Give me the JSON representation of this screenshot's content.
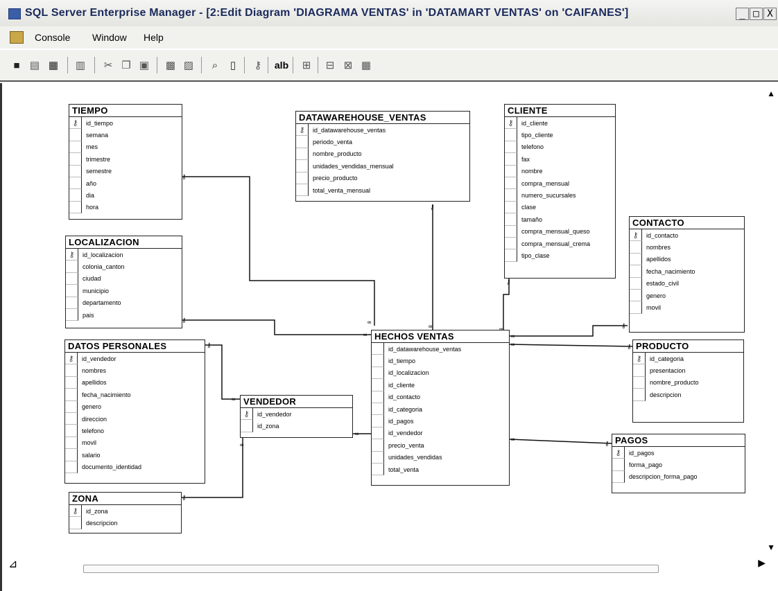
{
  "window": {
    "title": "SQL Server Enterprise Manager - [2:Edit Diagram 'DIAGRAMA VENTAS' in 'DATAMART VENTAS' on 'CAIFANES']",
    "controls": [
      "_",
      "□",
      "X"
    ],
    "doc_controls": [
      "_",
      "▫",
      "X"
    ]
  },
  "menu": {
    "items": [
      {
        "label": "Console"
      },
      {
        "label": "Window"
      },
      {
        "label": "Help"
      }
    ]
  },
  "toolbar": {
    "icons": [
      "save-icon",
      "properties-icon",
      "print-icon",
      "copy-table-icon",
      "cut-icon",
      "copy-icon",
      "paste-icon",
      "new-table-icon",
      "add-table-icon",
      "zoom-icon",
      "page-icon",
      "key-icon",
      "text-label-icon",
      "arrange-icon",
      "relationship-icon",
      "layout-icon",
      "grid-icon"
    ]
  },
  "tables": [
    {
      "id": "tiempo",
      "name": "TIEMPO",
      "fields": [
        "id_tiempo",
        "semana",
        "mes",
        "trimestre",
        "semestre",
        "año",
        "dia",
        "hora"
      ],
      "key_index": 0
    },
    {
      "id": "localizacion",
      "name": "LOCALIZACION",
      "fields": [
        "id_localizacion",
        "colonia_canton",
        "ciudad",
        "municipio",
        "departamento",
        "pais"
      ],
      "key_index": 0
    },
    {
      "id": "datos_personales",
      "name": "DATOS PERSONALES",
      "fields": [
        "id_vendedor",
        "nombres",
        "apellidos",
        "fecha_nacimiento",
        "genero",
        "direccion",
        "telefono",
        "movil",
        "salario",
        "documento_identidad"
      ],
      "key_index": 0
    },
    {
      "id": "zona",
      "name": "ZONA",
      "fields": [
        "id_zona",
        "descripcion"
      ],
      "key_index": 0
    },
    {
      "id": "vendedor",
      "name": "VENDEDOR",
      "fields": [
        "id_vendedor",
        "id_zona"
      ],
      "key_index": 0
    },
    {
      "id": "datawarehouse",
      "name": "DATAWAREHOUSE_VENTAS",
      "fields": [
        "id_datawarehouse_ventas",
        "periodo_venta",
        "nombre_producto",
        "unidades_vendidas_mensual",
        "precio_producto",
        "total_venta_mensual"
      ],
      "key_index": 0
    },
    {
      "id": "cliente",
      "name": "CLIENTE",
      "fields": [
        "id_cliente",
        "tipo_cliente",
        "telefono",
        "fax",
        "nombre",
        "compra_mensual",
        "numero_sucursales",
        "clase",
        "tamaño",
        "compra_mensual_queso",
        "compra_mensual_crema",
        "tipo_clase"
      ],
      "key_index": 0
    },
    {
      "id": "hechos",
      "name": "HECHOS VENTAS",
      "fields": [
        "id_datawarehouse_ventas",
        "id_tiempo",
        "id_localizacion",
        "id_cliente",
        "id_contacto",
        "id_categoria",
        "id_pagos",
        "id_vendedor",
        "precio_venta",
        "unidades_vendidas",
        "total_venta"
      ],
      "key_index": -1
    },
    {
      "id": "contacto",
      "name": "CONTACTO",
      "fields": [
        "id_contacto",
        "nombres",
        "apellidos",
        "fecha_nacimiento",
        "estado_civil",
        "genero",
        "movil"
      ],
      "key_index": 0
    },
    {
      "id": "producto",
      "name": "PRODUCTO",
      "fields": [
        "id_categoria",
        "presentacion",
        "nombre_producto",
        "descripcion"
      ],
      "key_index": 0
    },
    {
      "id": "pagos",
      "name": "PAGOS",
      "fields": [
        "id_pagos",
        "forma_pago",
        "descripcion_forma_pago"
      ],
      "key_index": 0
    }
  ]
}
